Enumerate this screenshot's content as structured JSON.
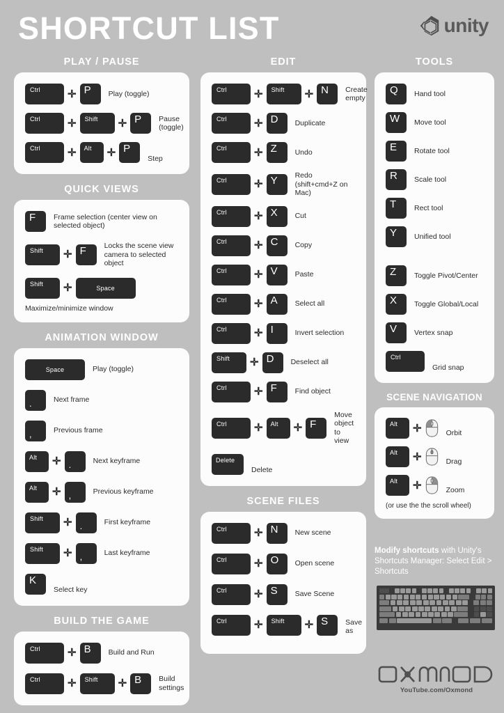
{
  "header": {
    "title": "SHORTCUT LIST",
    "logo_word": "unity",
    "logo_icon": "unity-cube-icon"
  },
  "sections": {
    "play_pause": {
      "title": "PLAY / PAUSE",
      "rows": [
        {
          "keys": [
            "Ctrl",
            "P"
          ],
          "label": "Play (toggle)"
        },
        {
          "keys": [
            "Ctrl",
            "Shift",
            "P"
          ],
          "label": "Pause (toggle)"
        },
        {
          "keys": [
            "Ctrl",
            "Alt",
            "P"
          ],
          "label": "Step"
        }
      ]
    },
    "quick_views": {
      "title": "QUICK VIEWS",
      "rows": [
        {
          "keys": [
            "F"
          ],
          "label": "Frame selection (center view on selected object)"
        },
        {
          "keys": [
            "Shift",
            "F"
          ],
          "label": "Locks the scene view camera to selected object"
        },
        {
          "keys": [
            "Shift",
            "Space"
          ],
          "label": ""
        }
      ],
      "note": "Maximize/minimize window"
    },
    "animation_window": {
      "title": "ANIMATION WINDOW",
      "rows": [
        {
          "keys": [
            "Space"
          ],
          "label": "Play (toggle)"
        },
        {
          "keys": [
            "."
          ],
          "label": "Next frame"
        },
        {
          "keys": [
            ","
          ],
          "label": "Previous frame"
        },
        {
          "keys": [
            "Alt",
            "."
          ],
          "label": "Next keyframe"
        },
        {
          "keys": [
            "Alt",
            ","
          ],
          "label": "Previous keyframe"
        },
        {
          "keys": [
            "Shift",
            "."
          ],
          "label": "First keyframe"
        },
        {
          "keys": [
            "Shift",
            ","
          ],
          "label": "Last keyframe"
        },
        {
          "keys": [
            "K"
          ],
          "label": "Select key"
        }
      ]
    },
    "build_the_game": {
      "title": "BUILD THE GAME",
      "rows": [
        {
          "keys": [
            "Ctrl",
            "B"
          ],
          "label": "Build and Run"
        },
        {
          "keys": [
            "Ctrl",
            "Shift",
            "B"
          ],
          "label": "Build settings"
        }
      ]
    },
    "edit": {
      "title": "EDIT",
      "rows": [
        {
          "keys": [
            "Ctrl",
            "Shift",
            "N"
          ],
          "label": "Create empty"
        },
        {
          "keys": [
            "Ctrl",
            "D"
          ],
          "label": "Duplicate"
        },
        {
          "keys": [
            "Ctrl",
            "Z"
          ],
          "label": "Undo"
        },
        {
          "keys": [
            "Ctrl",
            "Y"
          ],
          "label": "Redo",
          "sub": "(shift+cmd+Z on Mac)"
        },
        {
          "keys": [
            "Ctrl",
            "X"
          ],
          "label": "Cut"
        },
        {
          "keys": [
            "Ctrl",
            "C"
          ],
          "label": "Copy"
        },
        {
          "keys": [
            "Ctrl",
            "V"
          ],
          "label": "Paste"
        },
        {
          "keys": [
            "Ctrl",
            "A"
          ],
          "label": "Select all"
        },
        {
          "keys": [
            "Ctrl",
            "I"
          ],
          "label": "Invert selection"
        },
        {
          "keys": [
            "Shift",
            "D"
          ],
          "label": "Deselect all"
        },
        {
          "keys": [
            "Ctrl",
            "F"
          ],
          "label": "Find object"
        },
        {
          "keys": [
            "Ctrl",
            "Alt",
            "F"
          ],
          "label": "Move object to view"
        },
        {
          "keys": [
            "Delete"
          ],
          "label": "Delete"
        }
      ]
    },
    "scene_files": {
      "title": "SCENE FILES",
      "rows": [
        {
          "keys": [
            "Ctrl",
            "N"
          ],
          "label": "New scene"
        },
        {
          "keys": [
            "Ctrl",
            "O"
          ],
          "label": "Open scene"
        },
        {
          "keys": [
            "Ctrl",
            "S"
          ],
          "label": "Save Scene"
        },
        {
          "keys": [
            "Ctrl",
            "Shift",
            "S"
          ],
          "label": "Save as"
        }
      ]
    },
    "tools": {
      "title": "TOOLS",
      "rows": [
        {
          "keys": [
            "Q"
          ],
          "label": "Hand tool"
        },
        {
          "keys": [
            "W"
          ],
          "label": "Move tool"
        },
        {
          "keys": [
            "E"
          ],
          "label": "Rotate tool"
        },
        {
          "keys": [
            "R"
          ],
          "label": "Scale tool"
        },
        {
          "keys": [
            "T"
          ],
          "label": "Rect tool"
        },
        {
          "keys": [
            "Y"
          ],
          "label": "Unified tool"
        },
        {
          "keys": [
            "Z"
          ],
          "label": "Toggle Pivot/Center"
        },
        {
          "keys": [
            "X"
          ],
          "label": "Toggle Global/Local"
        },
        {
          "keys": [
            "V"
          ],
          "label": "Vertex snap"
        },
        {
          "keys": [
            "Ctrl"
          ],
          "label": "Grid snap"
        }
      ]
    },
    "scene_navigation": {
      "title": "SCENE NAVIGATION",
      "rows": [
        {
          "keys": [
            "Alt"
          ],
          "mouse": "mouse-left-button-icon",
          "label": "Orbit"
        },
        {
          "keys": [
            "Alt"
          ],
          "mouse": "mouse-wheel-icon",
          "label": "Drag"
        },
        {
          "keys": [
            "Alt"
          ],
          "mouse": "mouse-right-button-icon",
          "label": "Zoom"
        }
      ],
      "note": "(or use the the scroll wheel)"
    }
  },
  "footer": {
    "modify_bold": "Modify shortcuts",
    "modify_rest": " with Unity's Shortcuts Manager: Select Edit > Shortcuts",
    "keyboard_icon": "keyboard-illustration",
    "brand": "OXMOND",
    "brand_url": "YouTube.com/Oxmond"
  },
  "colors": {
    "background": "#bfbfbf",
    "panel": "#fcfcfc",
    "key": "#2b2b2b",
    "text": "#2b2b2b",
    "heading": "#ffffff"
  }
}
